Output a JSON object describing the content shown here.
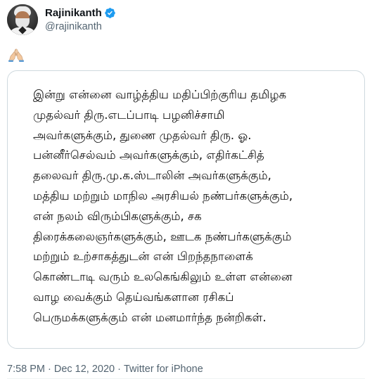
{
  "author": {
    "display_name": "Rajinikanth",
    "handle": "@rajinikanth",
    "verified": true
  },
  "tweet": {
    "emoji": "🙏🏻",
    "image_text_lines": [
      "இன்று என்னை வாழ்த்திய மதிப்பிற்குரிய தமிழக",
      "முதல்வர் திரு.எடப்பாடி பழனிச்சாமி",
      "அவர்களுக்கும், துணை முதல்வர் திரு. ஓ.",
      "பன்னீர்செல்வம் அவர்களுக்கும், எதிர்கட்சித்",
      "தலைவர் திரு.மு.க.ஸ்டாலின் அவர்களுக்கும்,",
      "மத்திய மற்றும் மாநில அரசியல் நண்பர்களுக்கும்,",
      "என் நலம் விரும்பிகளுக்கும், சக",
      "திரைக்கலைஞர்களுக்கும், ஊடக நண்பர்களுக்கும்",
      "மற்றும் உற்சாகத்துடன் என் பிறந்தநாளைக்",
      "கொண்டாடி வரும் உலகெங்கிலும் உள்ள என்னை",
      "வாழ வைக்கும் தெய்வங்களான ரசிகப்",
      "பெருமக்களுக்கும் என் மனமார்ந்த நன்றிகள்."
    ]
  },
  "meta": {
    "time": "7:58 PM",
    "separator": "·",
    "date": "Dec 12, 2020",
    "source": "Twitter for iPhone"
  },
  "colors": {
    "verified_badge": "#1d9bf0",
    "secondary_text": "#536471",
    "card_border": "#cfd9de"
  },
  "icons": {
    "verified": "verified-badge-icon",
    "emoji": "folded-hands-emoji"
  }
}
